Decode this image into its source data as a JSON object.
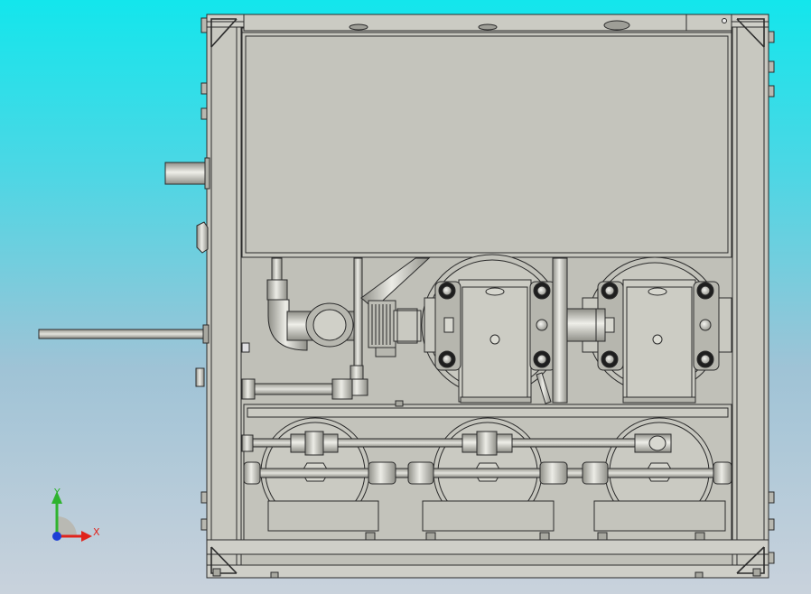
{
  "viewport": {
    "background_top": "#13e6ec",
    "background_bottom": "#c9d2dc",
    "model_fill": "#c5c5bd",
    "model_dark": "#a9a9a1",
    "edge_color": "#2b2b2b",
    "highlight": "#e8e8e3"
  },
  "triad": {
    "x_label": "X",
    "y_label": "Y",
    "x_color": "#e0241c",
    "y_color": "#2fb32f",
    "z_color": "#1c3fd6"
  },
  "icons": [
    "triad-icon"
  ]
}
